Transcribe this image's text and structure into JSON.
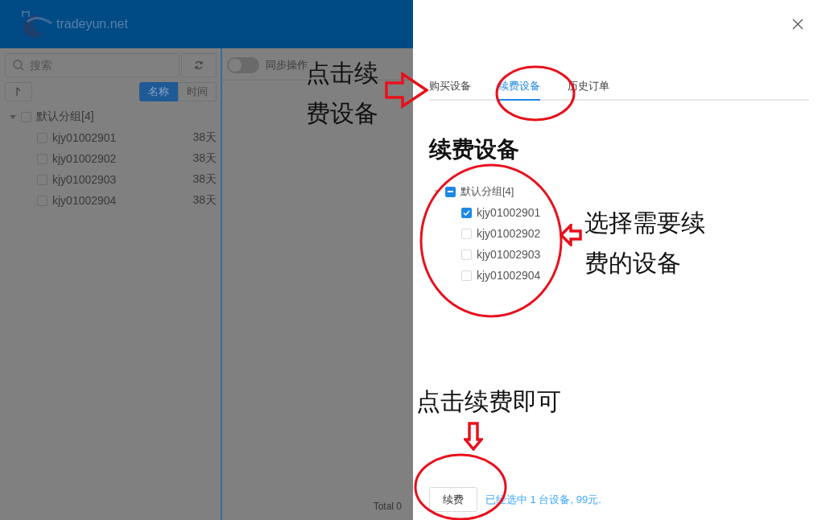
{
  "app": {
    "logo_text": "tradeyun.net",
    "search": {
      "placeholder": "搜索"
    },
    "sort_options": [
      {
        "label": "名称",
        "selected": true
      },
      {
        "label": "时间",
        "selected": false
      }
    ],
    "tree": {
      "label": "默认分组[4]",
      "expanded": true,
      "checked": false,
      "children": [
        {
          "label": "kjy01002901",
          "days": "38天",
          "checked": false
        },
        {
          "label": "kjy01002902",
          "days": "38天",
          "checked": false
        },
        {
          "label": "kjy01002903",
          "days": "38天",
          "checked": false
        },
        {
          "label": "kjy01002904",
          "days": "38天",
          "checked": false
        }
      ]
    },
    "sync": {
      "label": "同步操作",
      "on": false
    },
    "total": "Total 0"
  },
  "drawer": {
    "tabs": [
      {
        "label": "购买设备",
        "selected": false
      },
      {
        "label": "续费设备",
        "selected": true
      },
      {
        "label": "历史订单",
        "selected": false
      }
    ],
    "heading": "续费设备",
    "tree": {
      "label": "默认分组[4]",
      "expanded": true,
      "indeterminate": true,
      "children": [
        {
          "label": "kjy01002901",
          "checked": true
        },
        {
          "label": "kjy01002902",
          "checked": false
        },
        {
          "label": "kjy01002903",
          "checked": false
        },
        {
          "label": "kjy01002904",
          "checked": false
        }
      ]
    },
    "renew_button": "续费",
    "summary": "已经选中 1 台设备, 99元."
  },
  "annotations": [
    {
      "kind": "text",
      "text": "点击续费设备"
    },
    {
      "kind": "right_arrow"
    },
    {
      "kind": "ellipse"
    },
    {
      "kind": "ellipse"
    },
    {
      "kind": "left_arrow"
    },
    {
      "kind": "text",
      "text": "选择需要续费的设备"
    },
    {
      "kind": "text",
      "text": "点击续费即可"
    },
    {
      "kind": "down_arrow"
    },
    {
      "kind": "ellipse"
    }
  ]
}
